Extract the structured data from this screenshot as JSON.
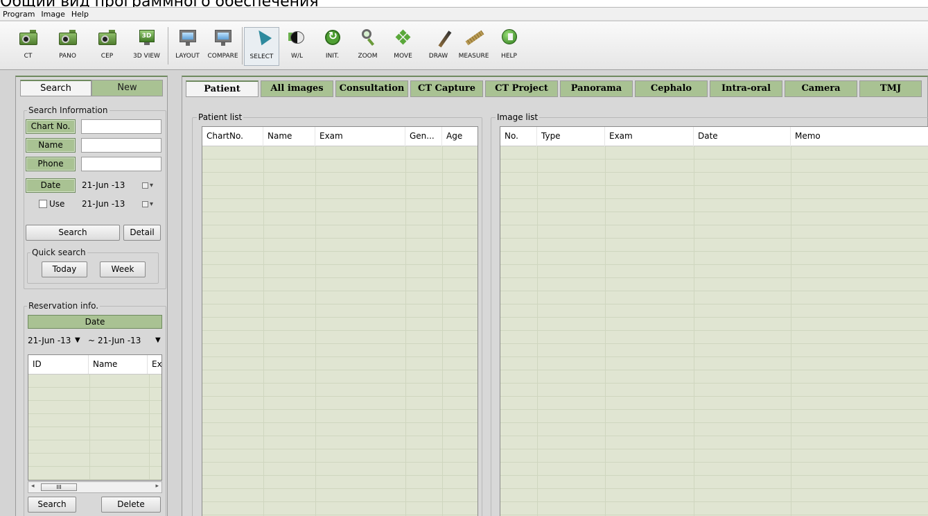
{
  "caption": "Общий вид программного обеспечения",
  "menu": [
    "Program",
    "Image",
    "Help"
  ],
  "toolbar": {
    "ct": "CT",
    "pano": "PANO",
    "cep": "CEP",
    "view3d": "3D VIEW",
    "layout": "LAYOUT",
    "compare": "COMPARE",
    "select": "SELECT",
    "wl": "W/L",
    "init": "INIT.",
    "zoom": "ZOOM",
    "move": "MOVE",
    "draw": "DRAW",
    "measure": "MEASURE",
    "help": "HELP"
  },
  "left": {
    "tabs": {
      "search": "Search",
      "new": "New"
    },
    "search_info": {
      "legend": "Search Information",
      "chart_label": "Chart No.",
      "chart_value": "",
      "name_label": "Name",
      "name_value": "",
      "phone_label": "Phone",
      "phone_value": "",
      "date_label": "Date",
      "date_from": "21-Jun -13",
      "use_label": "Use",
      "date_to": "21-Jun -13",
      "search_btn": "Search",
      "detail_btn": "Detail",
      "quick_legend": "Quick search",
      "today_btn": "Today",
      "week_btn": "Week"
    },
    "reservation": {
      "legend": "Reservation info.",
      "date_header": "Date",
      "from": "21-Jun -13",
      "tilde": "~",
      "to": "21-Jun -13",
      "columns": [
        "ID",
        "Name",
        "Ex"
      ],
      "scroll_thumb": "III",
      "search_btn": "Search",
      "delete_btn": "Delete"
    }
  },
  "main": {
    "tabs": [
      "Patient",
      "All images",
      "Consultation",
      "CT Capture",
      "CT Project",
      "Panorama",
      "Cephalo",
      "Intra-oral",
      "Camera",
      "TMJ"
    ],
    "patient_list": {
      "legend": "Patient list",
      "columns": [
        "ChartNo.",
        "Name",
        "Exam",
        "Gen...",
        "Age"
      ]
    },
    "image_list": {
      "legend": "Image list",
      "columns": [
        "No.",
        "Type",
        "Exam",
        "Date",
        "Memo"
      ]
    }
  },
  "colors": {
    "accent_green": "#a9c293",
    "grid_bg": "#e3e6d8",
    "panel_bg": "#d8d8d8"
  }
}
